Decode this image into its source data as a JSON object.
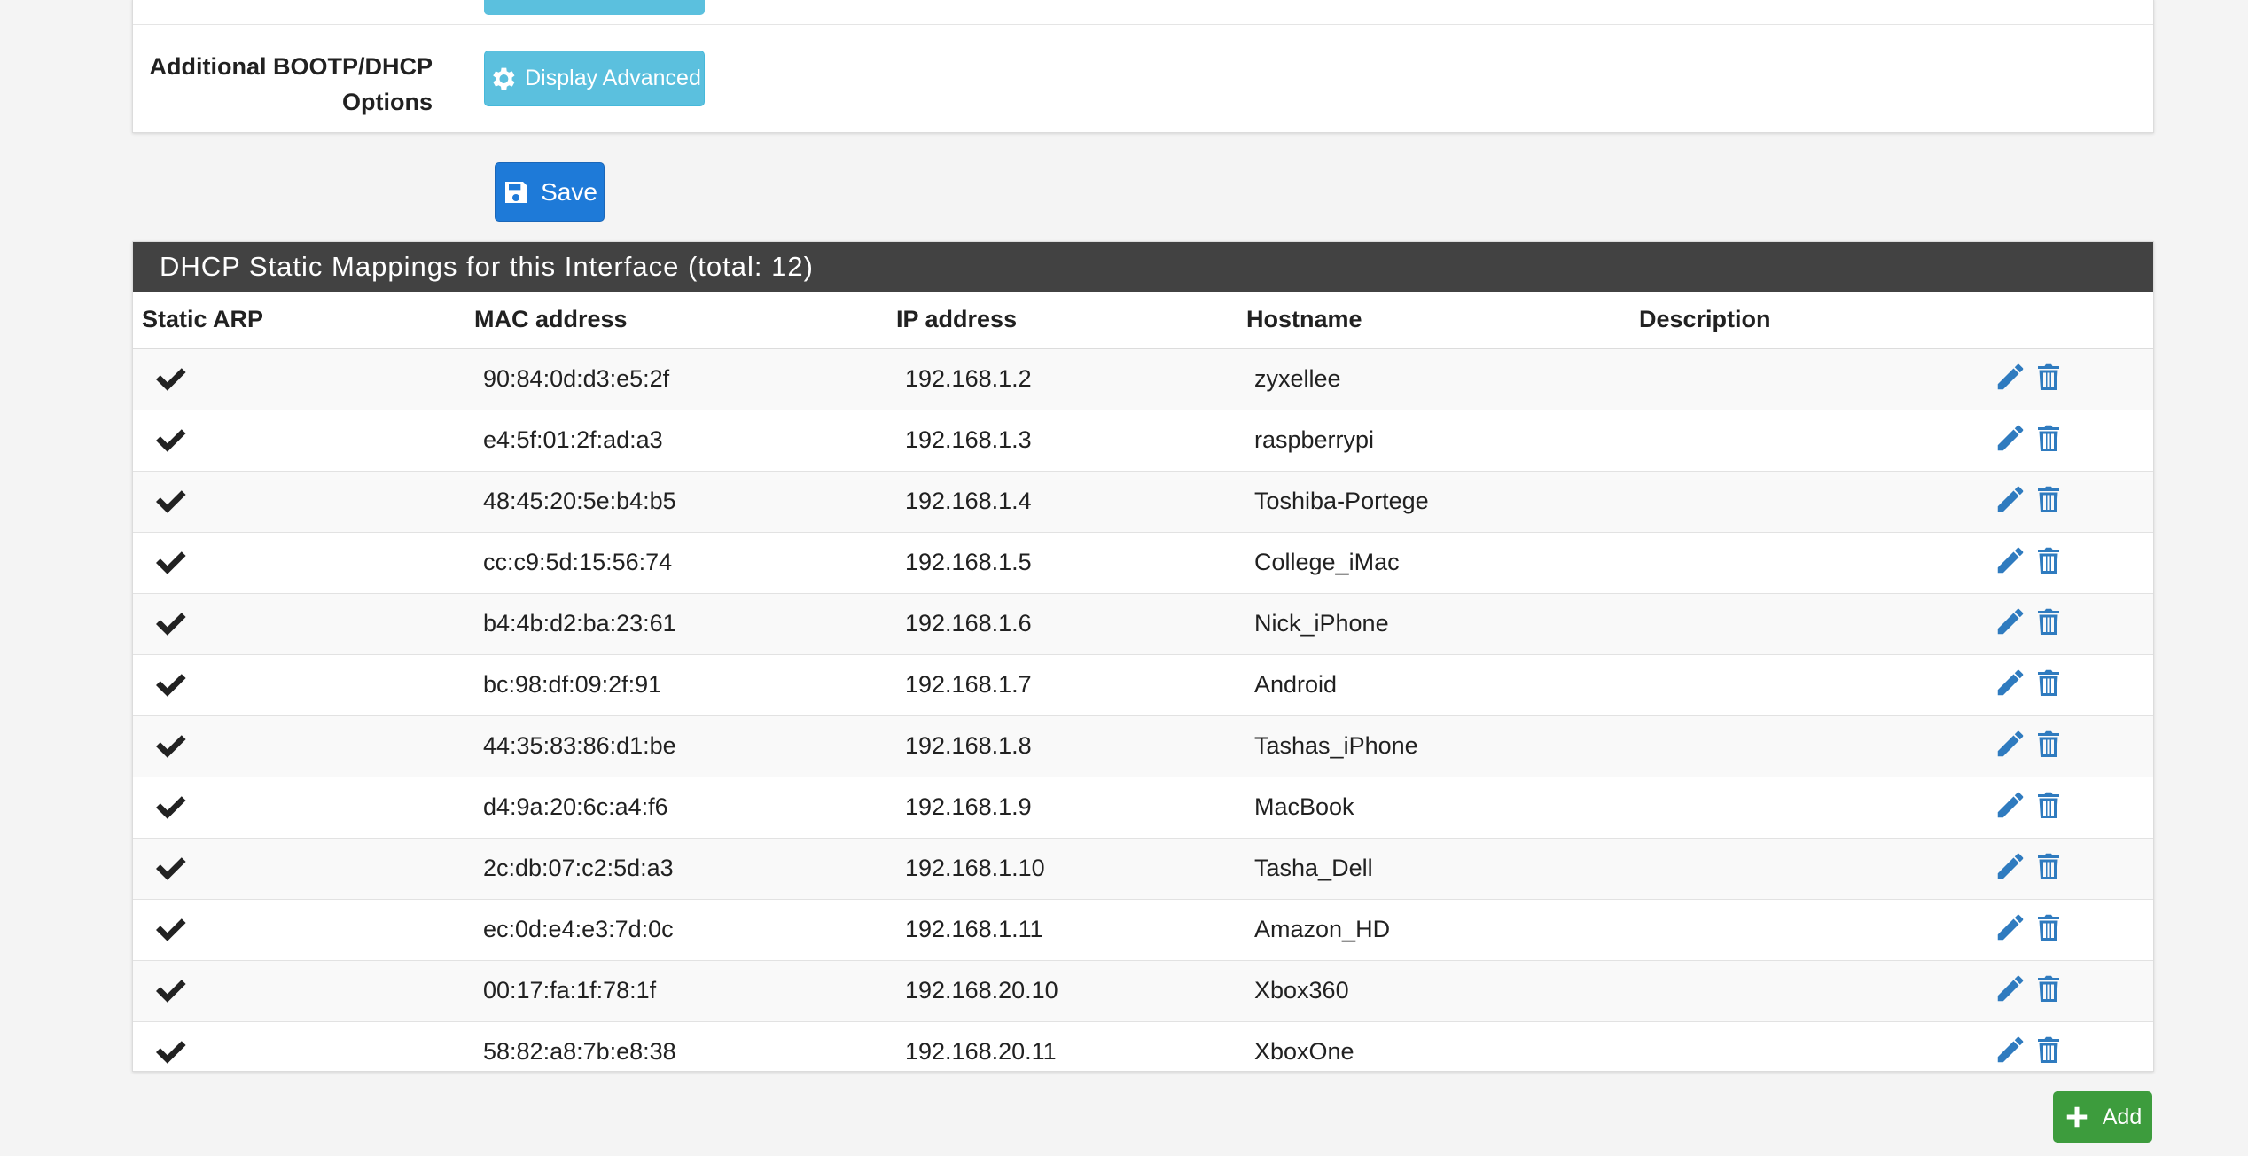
{
  "form": {
    "options_label": "Additional BOOTP/DHCP Options",
    "display_advanced_label": "Display Advanced",
    "save_label": "Save"
  },
  "table": {
    "title": "DHCP Static Mappings for this Interface (total: 12)",
    "columns": {
      "static_arp": "Static ARP",
      "mac": "MAC address",
      "ip": "IP address",
      "hostname": "Hostname",
      "description": "Description"
    },
    "rows": [
      {
        "static_arp": true,
        "mac": "90:84:0d:d3:e5:2f",
        "ip": "192.168.1.2",
        "hostname": "zyxellee",
        "description": ""
      },
      {
        "static_arp": true,
        "mac": "e4:5f:01:2f:ad:a3",
        "ip": "192.168.1.3",
        "hostname": "raspberrypi",
        "description": ""
      },
      {
        "static_arp": true,
        "mac": "48:45:20:5e:b4:b5",
        "ip": "192.168.1.4",
        "hostname": "Toshiba-Portege",
        "description": ""
      },
      {
        "static_arp": true,
        "mac": "cc:c9:5d:15:56:74",
        "ip": "192.168.1.5",
        "hostname": "College_iMac",
        "description": ""
      },
      {
        "static_arp": true,
        "mac": "b4:4b:d2:ba:23:61",
        "ip": "192.168.1.6",
        "hostname": "Nick_iPhone",
        "description": ""
      },
      {
        "static_arp": true,
        "mac": "bc:98:df:09:2f:91",
        "ip": "192.168.1.7",
        "hostname": "Android",
        "description": ""
      },
      {
        "static_arp": true,
        "mac": "44:35:83:86:d1:be",
        "ip": "192.168.1.8",
        "hostname": "Tashas_iPhone",
        "description": ""
      },
      {
        "static_arp": true,
        "mac": "d4:9a:20:6c:a4:f6",
        "ip": "192.168.1.9",
        "hostname": "MacBook",
        "description": ""
      },
      {
        "static_arp": true,
        "mac": "2c:db:07:c2:5d:a3",
        "ip": "192.168.1.10",
        "hostname": "Tasha_Dell",
        "description": ""
      },
      {
        "static_arp": true,
        "mac": "ec:0d:e4:e3:7d:0c",
        "ip": "192.168.1.11",
        "hostname": "Amazon_HD",
        "description": ""
      },
      {
        "static_arp": true,
        "mac": "00:17:fa:1f:78:1f",
        "ip": "192.168.20.10",
        "hostname": "Xbox360",
        "description": ""
      },
      {
        "static_arp": true,
        "mac": "58:82:a8:7b:e8:38",
        "ip": "192.168.20.11",
        "hostname": "XboxOne",
        "description": ""
      }
    ],
    "add_label": "Add"
  },
  "icons": {
    "gear": "gear-icon",
    "save": "floppy-disk-icon",
    "check": "checkmark-icon",
    "edit": "pencil-icon",
    "delete": "trash-icon",
    "add": "plus-icon"
  },
  "colors": {
    "info_button": "#5bc0de",
    "primary_button": "#1e7ad8",
    "success_button": "#3d9c3d",
    "table_header": "#424242",
    "action_icon": "#2f7bbf"
  }
}
